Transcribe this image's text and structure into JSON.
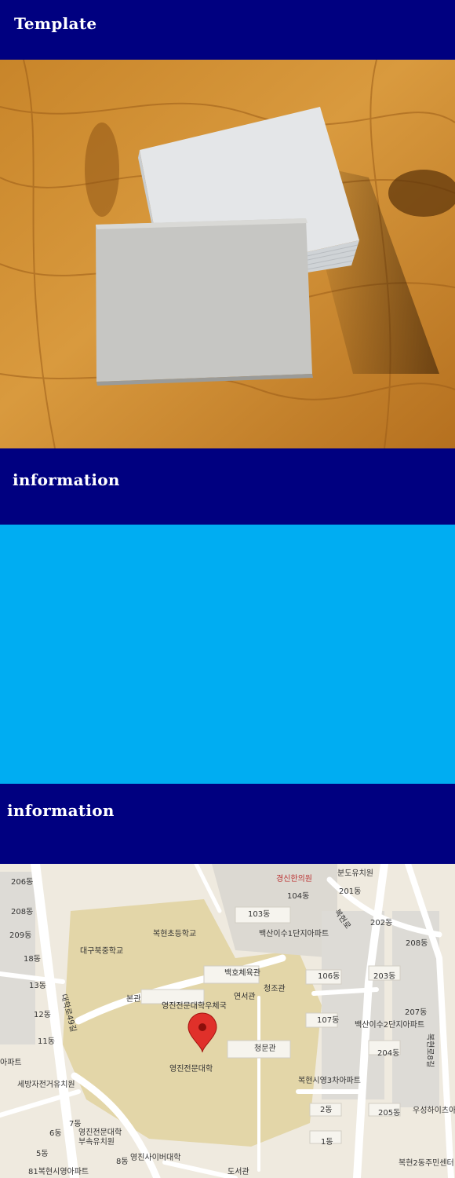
{
  "header": {
    "title": "Template"
  },
  "section1": {
    "title": "information"
  },
  "section2": {
    "title": "information"
  },
  "colors": {
    "nav": "#000080",
    "panel": "#00adf2"
  },
  "map": {
    "labels": [
      "206동",
      "208동",
      "209동",
      "18동",
      "13동",
      "12동",
      "11동",
      "아파트",
      "세방자전거유치원",
      "대구북중학교",
      "복현초등학교",
      "103동",
      "경신한의원",
      "104동",
      "분도유치원",
      "201동",
      "복현로",
      "백산이수1단지아파트",
      "202동",
      "208동",
      "백호체육관",
      "본관",
      "영진전문대학우체국",
      "연서관",
      "청조관",
      "106동",
      "203동",
      "107동",
      "백산이수2단지아파트",
      "207동",
      "청문관",
      "204동",
      "영진전문대학",
      "복현시영3차아파트",
      "2동",
      "205동",
      "우성하이츠아파트",
      "7동",
      "6동",
      "영진전문대학 부속유치원",
      "5동",
      "8동",
      "영진사이버대학",
      "1동",
      "81복현시영아파트",
      "도서관",
      "복현2동주민센터",
      "대학로49길",
      "복현로8길"
    ]
  }
}
